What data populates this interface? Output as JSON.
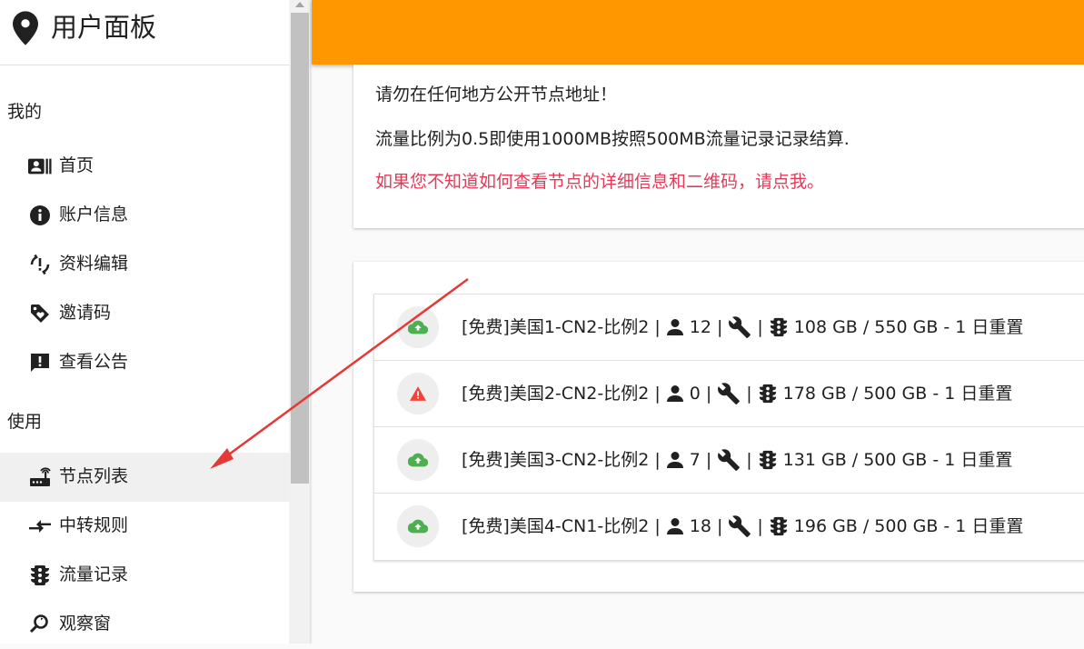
{
  "sidebar": {
    "title": "用户面板",
    "sections": [
      {
        "header": "我的"
      },
      {
        "header": "使用"
      }
    ],
    "items": [
      {
        "label": "首页",
        "icon": "account-box-icon"
      },
      {
        "label": "账户信息",
        "icon": "info-icon"
      },
      {
        "label": "资料编辑",
        "icon": "sync-problem-icon"
      },
      {
        "label": "邀请码",
        "icon": "loyalty-tag-icon"
      },
      {
        "label": "查看公告",
        "icon": "announcement-icon"
      },
      {
        "label": "节点列表",
        "icon": "router-icon",
        "active": true
      },
      {
        "label": "中转规则",
        "icon": "compare-arrows-icon"
      },
      {
        "label": "流量记录",
        "icon": "traffic-light-icon"
      },
      {
        "label": "观察窗",
        "icon": "find-replace-icon"
      }
    ]
  },
  "header": {
    "color": "#ff9800"
  },
  "notice": {
    "line1": "请勿在任何地方公开节点地址！",
    "line2": "流量比例为0.5即使用1000MB按照500MB流量记录记录结算.",
    "line3": "如果您不知道如何查看节点的详细信息和二维码，请点我。",
    "warn_color": "#e53958"
  },
  "nodes": [
    {
      "name": "[免费]美国1-CN2-比例2 |",
      "users": "12 |",
      "sep": "|",
      "traffic": "108 GB / 550 GB - 1 日重置",
      "status": "online",
      "status_icon": "cloud-upload-icon",
      "status_color": "#4caf50"
    },
    {
      "name": "[免费]美国2-CN2-比例2 |",
      "users": "0 |",
      "sep": "|",
      "traffic": "178 GB / 500 GB - 1 日重置",
      "status": "warning",
      "status_icon": "warning-icon",
      "status_color": "#f44336"
    },
    {
      "name": "[免费]美国3-CN2-比例2 |",
      "users": "7 |",
      "sep": "|",
      "traffic": "131 GB / 500 GB - 1 日重置",
      "status": "online",
      "status_icon": "cloud-upload-icon",
      "status_color": "#4caf50"
    },
    {
      "name": "[免费]美国4-CN1-比例2 |",
      "users": "18 |",
      "sep": "|",
      "traffic": "196 GB / 500 GB - 1 日重置",
      "status": "online",
      "status_icon": "cloud-upload-icon",
      "status_color": "#4caf50"
    }
  ],
  "annotation": {
    "color": "#e53935"
  }
}
